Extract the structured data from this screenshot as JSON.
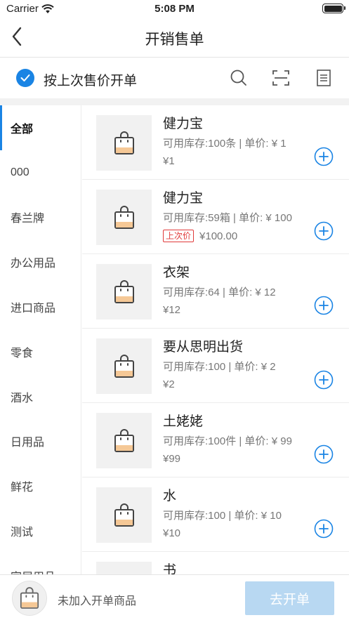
{
  "status": {
    "carrier": "Carrier",
    "time": "5:08 PM"
  },
  "nav": {
    "title": "开销售单"
  },
  "options": {
    "last_price_label": "按上次售价开单",
    "checked": true
  },
  "categories": [
    {
      "label": "全部",
      "active": true
    },
    {
      "label": "000"
    },
    {
      "label": "春兰牌"
    },
    {
      "label": "办公用品"
    },
    {
      "label": "进口商品"
    },
    {
      "label": "零食"
    },
    {
      "label": "酒水"
    },
    {
      "label": "日用品"
    },
    {
      "label": "鲜花"
    },
    {
      "label": "测试"
    },
    {
      "label": "家居用品"
    }
  ],
  "products": [
    {
      "name": "健力宝",
      "meta": "可用库存:100条 | 单价: ¥ 1",
      "price": "¥1",
      "tag": ""
    },
    {
      "name": "健力宝",
      "meta": "可用库存:59箱 | 单价: ¥ 100",
      "price": "¥100.00",
      "tag": "上次价"
    },
    {
      "name": "衣架",
      "meta": "可用库存:64 | 单价: ¥ 12",
      "price": "¥12",
      "tag": ""
    },
    {
      "name": "要从思明出货",
      "meta": "可用库存:100 | 单价: ¥ 2",
      "price": "¥2",
      "tag": ""
    },
    {
      "name": "土姥姥",
      "meta": "可用库存:100件 | 单价: ¥ 99",
      "price": "¥99",
      "tag": ""
    },
    {
      "name": "水",
      "meta": "可用库存:100 | 单价: ¥ 10",
      "price": "¥10",
      "tag": ""
    },
    {
      "name": "书",
      "meta": "",
      "price": "",
      "tag": ""
    }
  ],
  "bottom": {
    "cart_text": "未加入开单商品",
    "submit_label": "去开单"
  },
  "colors": {
    "accent": "#1a84e4",
    "submit_disabled": "#b8d8f2",
    "tag_red": "#e03a3a"
  }
}
